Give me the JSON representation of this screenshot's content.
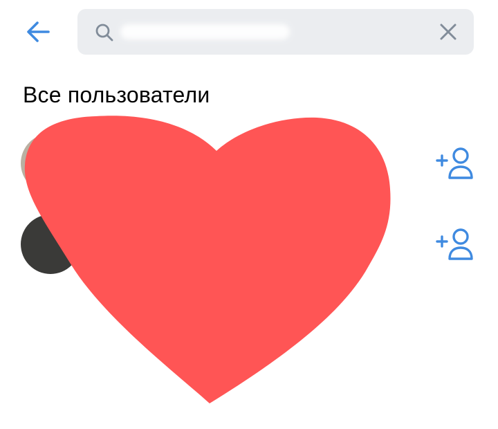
{
  "colors": {
    "accent": "#3f8ae0",
    "search_bg": "#ebedf0",
    "icon_gray": "#818c99",
    "redaction": "#ff5555"
  },
  "header": {
    "back_icon": "arrow-left-icon",
    "search": {
      "icon": "search-icon",
      "value": "",
      "clear_icon": "close-icon"
    }
  },
  "section": {
    "title": "Все пользователи"
  },
  "users": [
    {
      "action_icon": "add-friend-icon"
    },
    {
      "action_icon": "add-friend-icon"
    }
  ]
}
